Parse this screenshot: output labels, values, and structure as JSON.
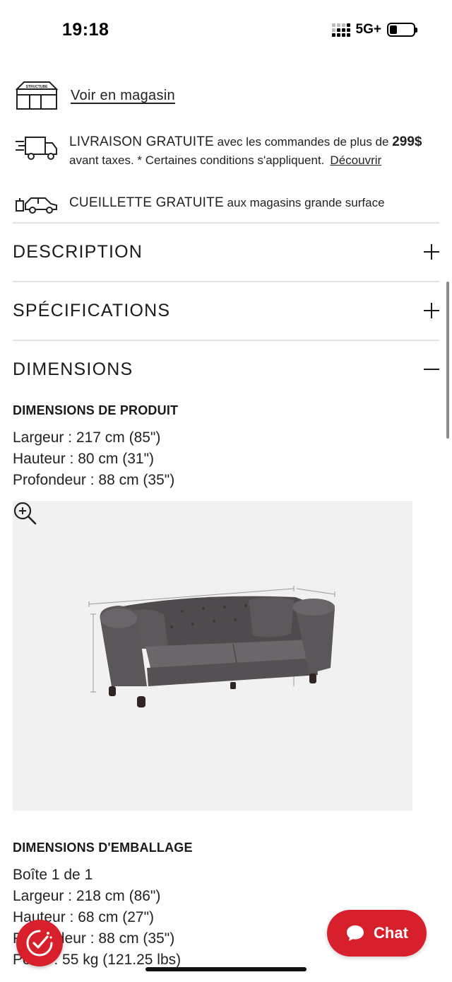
{
  "status_bar": {
    "time": "19:18",
    "network": "5G+"
  },
  "store": {
    "icon_label": "STRUCTUBE",
    "link": "Voir en magasin"
  },
  "delivery": {
    "caps": "LIVRAISON GRATUITE",
    "text1": " avec les commandes de plus de ",
    "amount": "299$",
    "text2": "avant taxes. * Certaines conditions s'appliquent.",
    "link": "Découvrir"
  },
  "pickup": {
    "caps": "CUEILLETTE GRATUITE",
    "text": " aux magasins grande surface"
  },
  "accordion": {
    "description": "DESCRIPTION",
    "specifications": "SPÉCIFICATIONS",
    "dimensions": "DIMENSIONS"
  },
  "product_dimensions": {
    "heading": "DIMENSIONS DE PRODUIT",
    "lines": [
      "Largeur : 217 cm (85\")",
      "Hauteur : 80 cm (31\")",
      "Profondeur : 88 cm (35\")"
    ]
  },
  "packaging": {
    "heading": "DIMENSIONS D'EMBALLAGE",
    "box": "Boîte 1 de 1",
    "lines": [
      "Largeur : 218 cm (86\")",
      "Hauteur : 68 cm (27\")",
      "Profondeur : 88 cm (35\")",
      "Poids : 55 kg (121.25 lbs)"
    ]
  },
  "chat": {
    "label": "Chat"
  },
  "colors": {
    "accent": "#d8202c",
    "image_bg": "#f1f1f1",
    "sofa": "#5a5558"
  },
  "icons": [
    "store-icon",
    "delivery-truck-icon",
    "pickup-car-icon",
    "plus-icon",
    "minus-icon",
    "zoom-in-icon",
    "chat-bubble-icon",
    "consent-icon"
  ]
}
